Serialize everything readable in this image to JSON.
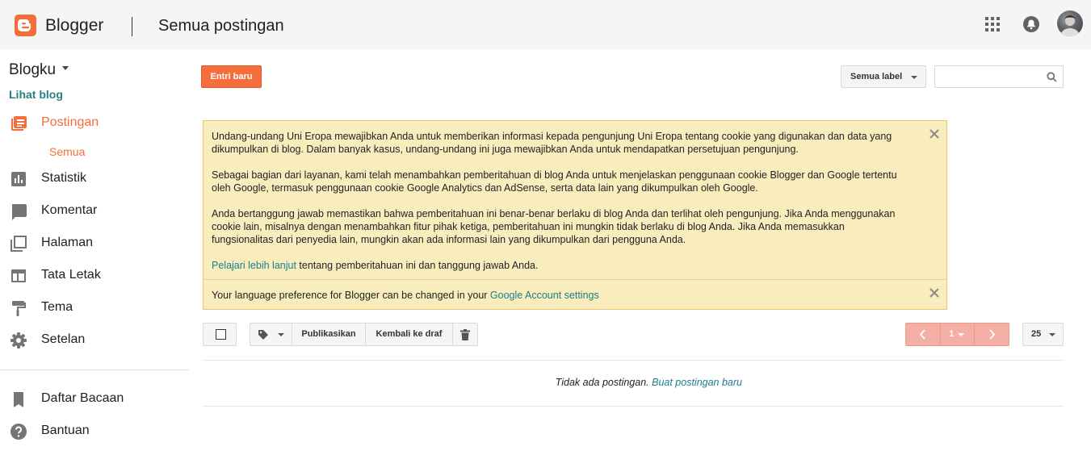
{
  "header": {
    "brand": "Blogger",
    "page_title": "Semua postingan",
    "icons": [
      "apps-grid-icon",
      "notifications-bell-icon",
      "account-avatar"
    ]
  },
  "sidebar": {
    "blog_name": "Blogku",
    "view_blog": "Lihat blog",
    "items": [
      {
        "label": "Postingan",
        "icon": "posts-icon",
        "active": true
      },
      {
        "label": "Statistik",
        "icon": "stats-icon"
      },
      {
        "label": "Komentar",
        "icon": "comment-icon"
      },
      {
        "label": "Halaman",
        "icon": "pages-icon"
      },
      {
        "label": "Tata Letak",
        "icon": "layout-icon"
      },
      {
        "label": "Tema",
        "icon": "theme-brush-icon"
      },
      {
        "label": "Setelan",
        "icon": "gear-icon"
      }
    ],
    "sub_item": "Semua",
    "bottom_items": [
      {
        "label": "Daftar Bacaan",
        "icon": "bookmark-icon"
      },
      {
        "label": "Bantuan",
        "icon": "help-icon"
      }
    ]
  },
  "toolbar_top": {
    "new_post": "Entri baru",
    "label_filter": "Semua label",
    "search_placeholder": ""
  },
  "notice": {
    "p1": "Undang-undang Uni Eropa mewajibkan Anda untuk memberikan informasi kepada pengunjung Uni Eropa tentang cookie yang digunakan dan data yang dikumpulkan di blog. Dalam banyak kasus, undang-undang ini juga mewajibkan Anda untuk mendapatkan persetujuan pengunjung.",
    "p2": "Sebagai bagian dari layanan, kami telah menambahkan pemberitahuan di blog Anda untuk menjelaskan penggunaan cookie Blogger dan Google tertentu oleh Google, termasuk penggunaan cookie Google Analytics dan AdSense, serta data lain yang dikumpulkan oleh Google.",
    "p3": "Anda bertanggung jawab memastikan bahwa pemberitahuan ini benar-benar berlaku di blog Anda dan terlihat oleh pengunjung. Jika Anda menggunakan cookie lain, misalnya dengan menambahkan fitur pihak ketiga, pemberitahuan ini mungkin tidak berlaku di blog Anda. Jika Anda memasukkan fungsionalitas dari penyedia lain, mungkin akan ada informasi lain yang dikumpulkan dari pengguna Anda.",
    "p4_link": "Pelajari lebih lanjut",
    "p4_text": " tentang pemberitahuan ini dan tanggung jawab Anda.",
    "lang_text": "Your language preference for Blogger can be changed in your ",
    "lang_link": "Google Account settings"
  },
  "toolbar": {
    "publish": "Publikasikan",
    "revert_draft": "Kembali ke draf",
    "page": "1",
    "per_page": "25"
  },
  "list": {
    "empty_text": "Tidak ada postingan. ",
    "create_link": "Buat postingan baru"
  },
  "colors": {
    "brand_orange": "#f36e3b",
    "teal_link": "#1a7d8a",
    "notice_bg": "#f9edbe",
    "pager_bg": "#f4b0a5"
  }
}
